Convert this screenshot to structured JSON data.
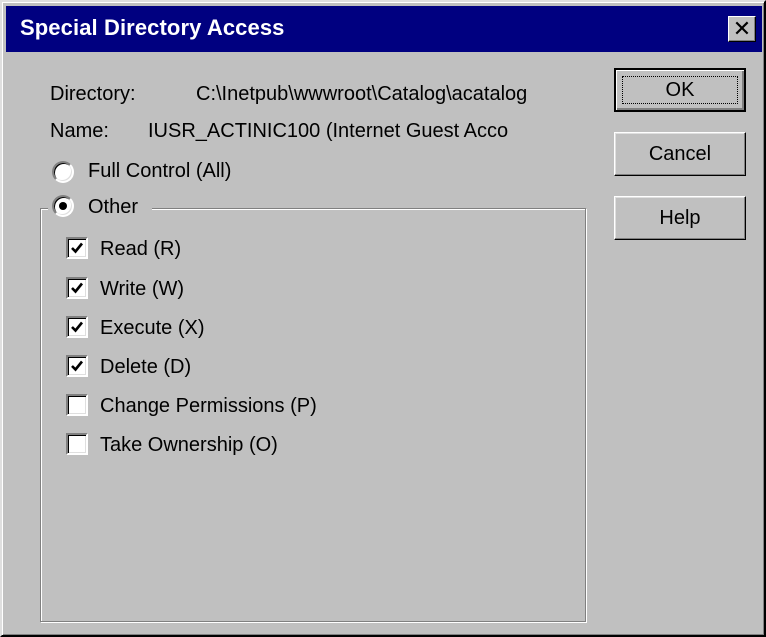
{
  "dialog": {
    "title": "Special Directory Access",
    "close_glyph": "✕"
  },
  "directory": {
    "label": "Directory:",
    "value": "C:\\Inetpub\\wwwroot\\Catalog\\acatalog"
  },
  "name": {
    "label": "Name:",
    "value": "IUSR_ACTINIC100 (Internet Guest Acco"
  },
  "access": {
    "full_control": {
      "label": "Full Control (All)",
      "selected": false
    },
    "other": {
      "label": "Other",
      "selected": true
    }
  },
  "permissions": [
    {
      "label": "Read (R)",
      "checked": true
    },
    {
      "label": "Write (W)",
      "checked": true
    },
    {
      "label": "Execute (X)",
      "checked": true
    },
    {
      "label": "Delete (D)",
      "checked": true
    },
    {
      "label": "Change Permissions (P)",
      "checked": false
    },
    {
      "label": "Take Ownership (O)",
      "checked": false
    }
  ],
  "buttons": {
    "ok": "OK",
    "cancel": "Cancel",
    "help": "Help"
  },
  "icons": {
    "check": "check-icon",
    "close": "close-icon",
    "radio_dot": "radio-dot-icon"
  },
  "colors": {
    "titlebar": "#000080",
    "face": "#c0c0c0"
  }
}
